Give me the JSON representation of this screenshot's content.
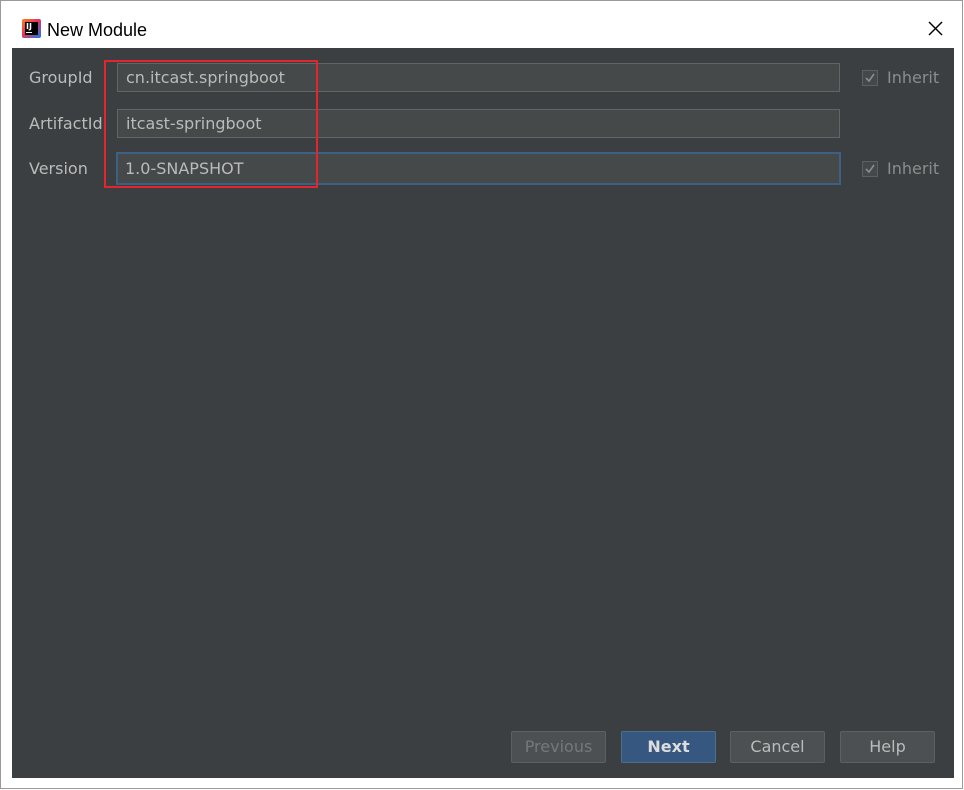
{
  "window": {
    "title": "New Module",
    "app_icon_text": "IJ"
  },
  "form": {
    "fields": [
      {
        "label": "GroupId",
        "value": "cn.itcast.springboot",
        "inherit": true,
        "inherit_label": "Inherit"
      },
      {
        "label": "ArtifactId",
        "value": "itcast-springboot"
      },
      {
        "label": "Version",
        "value": "1.0-SNAPSHOT",
        "inherit": true,
        "inherit_label": "Inherit"
      }
    ]
  },
  "buttons": {
    "previous": "Previous",
    "next": "Next",
    "cancel": "Cancel",
    "help": "Help"
  },
  "colors": {
    "dialog_bg": "#3c3f41",
    "field_bg": "#45494a",
    "focus_border": "#3d6185",
    "primary_button": "#365880",
    "highlight_box": "#e3262d"
  }
}
